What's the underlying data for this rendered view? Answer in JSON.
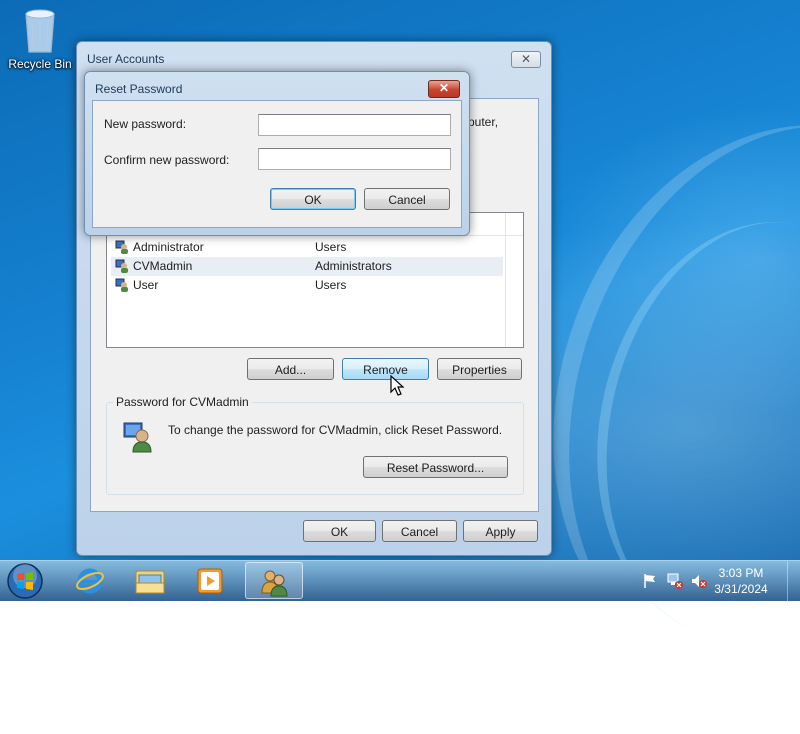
{
  "desktop": {
    "recycle_bin_label": "Recycle Bin"
  },
  "user_accounts_window": {
    "title": "User Accounts",
    "partial_text": "puter,",
    "users": [
      {
        "name": "Administrator",
        "group": "Users"
      },
      {
        "name": "CVMadmin",
        "group": "Administrators",
        "selected": true
      },
      {
        "name": "User",
        "group": "Users"
      }
    ],
    "add_label": "Add...",
    "remove_label": "Remove",
    "properties_label": "Properties",
    "password_group_label": "Password for CVMadmin",
    "password_instruction": "To change the password for CVMadmin, click Reset Password.",
    "reset_password_label": "Reset Password...",
    "ok_label": "OK",
    "cancel_label": "Cancel",
    "apply_label": "Apply"
  },
  "reset_password_dialog": {
    "title": "Reset Password",
    "new_password_label": "New password:",
    "confirm_password_label": "Confirm new password:",
    "new_password_value": "",
    "confirm_password_value": "",
    "ok_label": "OK",
    "cancel_label": "Cancel"
  },
  "taskbar": {
    "time": "3:03 PM",
    "date": "3/31/2024",
    "pinned": [
      "start-orb",
      "internet-explorer-icon",
      "windows-explorer-icon",
      "media-player-icon",
      "user-accounts-icon"
    ]
  },
  "colors": {
    "accent": "#3c7fb1",
    "desktop_blue": "#1581d0"
  }
}
